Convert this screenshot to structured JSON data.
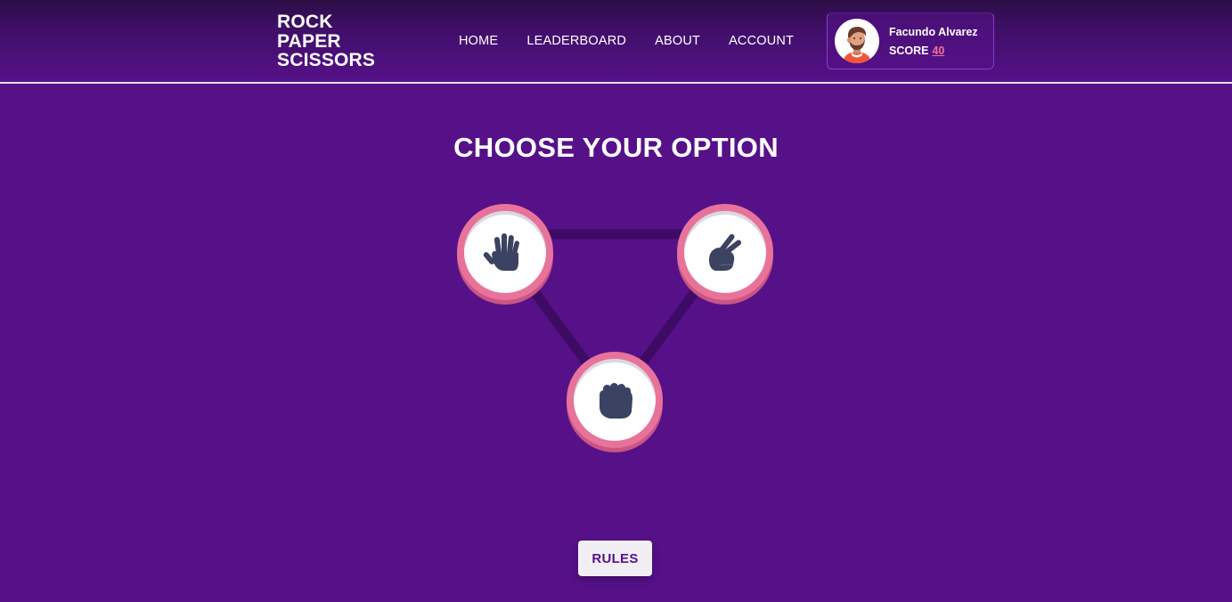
{
  "app": {
    "logo_lines": [
      "ROCK",
      "PAPER",
      "SCISSORS"
    ]
  },
  "nav": {
    "items": [
      {
        "label": "HOME"
      },
      {
        "label": "LEADERBOARD"
      },
      {
        "label": "ABOUT"
      },
      {
        "label": "ACCOUNT"
      }
    ]
  },
  "user": {
    "name": "Facundo Alvarez",
    "score_label": "SCORE",
    "score_value": "40",
    "avatar_icon": "user-avatar-bearded-man"
  },
  "game": {
    "title": "CHOOSE YOUR OPTION",
    "choices": [
      {
        "name": "paper",
        "icon": "hand-paper-icon"
      },
      {
        "name": "scissors",
        "icon": "hand-scissors-icon"
      },
      {
        "name": "rock",
        "icon": "hand-rock-icon"
      }
    ],
    "rules_label": "RULES"
  },
  "colors": {
    "background": "#561189",
    "accent_ring": "#e8739a",
    "icon_color": "#3b4262",
    "score_color": "#f0739b"
  }
}
